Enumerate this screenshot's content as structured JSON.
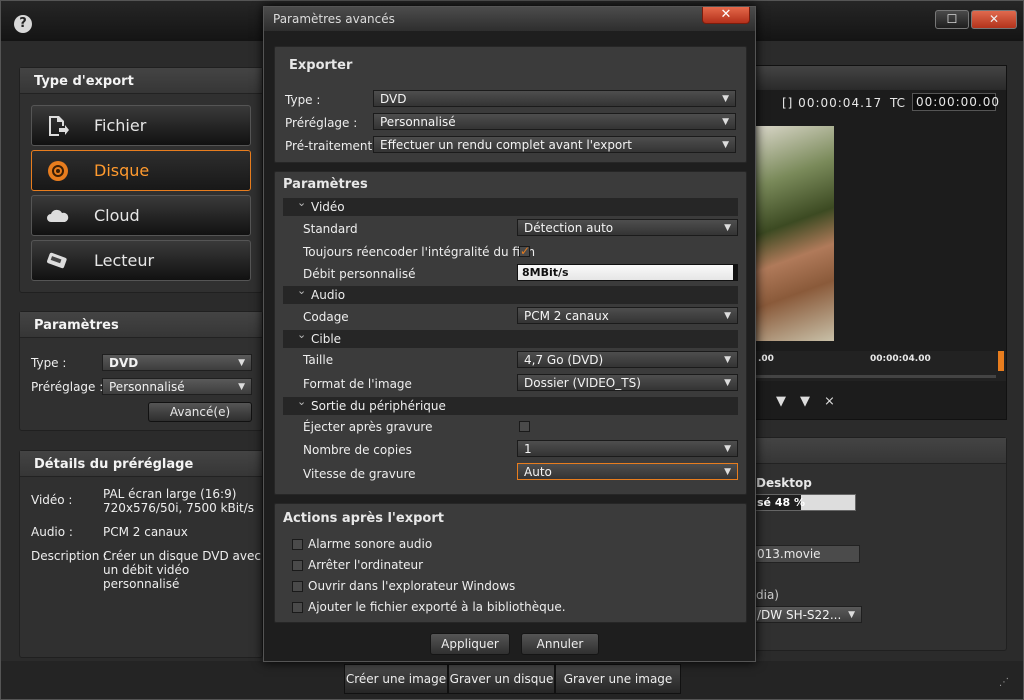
{
  "app": {
    "help": "?",
    "maximize": "☐",
    "close": "✕"
  },
  "export_type": {
    "title": "Type d'export",
    "items": [
      {
        "label": "Fichier",
        "icon": "file-export-icon"
      },
      {
        "label": "Disque",
        "icon": "disc-icon"
      },
      {
        "label": "Cloud",
        "icon": "cloud-icon"
      },
      {
        "label": "Lecteur",
        "icon": "device-icon"
      }
    ]
  },
  "params": {
    "title": "Paramètres",
    "type_label": "Type :",
    "type_value": "DVD",
    "preset_label": "Préréglage :",
    "preset_value": "Personnalisé",
    "advanced": "Avancé(e)"
  },
  "details": {
    "title": "Détails du préréglage",
    "video_label": "Vidéo :",
    "video_value_1": "PAL écran large (16:9)",
    "video_value_2": "720x576/50i, 7500 kBit/s",
    "audio_label": "Audio :",
    "audio_value": "PCM 2 canaux",
    "desc_label": "Description :",
    "desc_value_1": "Créer un disque DVD avec",
    "desc_value_2": "un débit vidéo personnalisé"
  },
  "preview": {
    "timecode": "[] 00:00:04.17",
    "tc_label": "TC",
    "tc_value": "00:00:00.00",
    "ruler_1": ".00",
    "ruler_2": "00:00:04.00"
  },
  "output": {
    "desktop": "Desktop",
    "progress_text": "sé 48 %",
    "progress": 0.48,
    "filename": "013.movie",
    "media": "dia)",
    "drive": "/DW SH-S22..."
  },
  "bottom": {
    "create_image": "Créer une image",
    "burn_disc": "Graver un disque",
    "burn_image": "Graver une image"
  },
  "dialog": {
    "title": "Paramètres avancés",
    "close": "✕",
    "exporter": {
      "title": "Exporter",
      "type_label": "Type :",
      "type_value": "DVD",
      "preset_label": "Préréglage :",
      "preset_value": "Personnalisé",
      "pre_label": "Pré-traitement :",
      "pre_value": "Effectuer un rendu complet avant l'export"
    },
    "settings": {
      "title": "Paramètres",
      "video": {
        "title": "Vidéo",
        "standard_label": "Standard",
        "standard_value": "Détection auto",
        "reencode_label": "Toujours réencoder l'intégralité du film",
        "reencode_checked": true,
        "bitrate_label": "Débit personnalisé",
        "bitrate_value": "8MBit/s"
      },
      "audio": {
        "title": "Audio",
        "codec_label": "Codage",
        "codec_value": "PCM 2 canaux"
      },
      "target": {
        "title": "Cible",
        "size_label": "Taille",
        "size_value": "4,7 Go (DVD)",
        "format_label": "Format de l'image",
        "format_value": "Dossier (VIDEO_TS)"
      },
      "device": {
        "title": "Sortie du périphérique",
        "eject_label": "Éjecter après gravure",
        "copies_label": "Nombre de copies",
        "copies_value": "1",
        "speed_label": "Vitesse de gravure",
        "speed_value": "Auto"
      }
    },
    "actions": {
      "title": "Actions après l'export",
      "items": [
        "Alarme sonore audio",
        "Arrêter l'ordinateur",
        "Ouvrir dans l'explorateur Windows",
        "Ajouter le fichier exporté à la bibliothèque."
      ]
    },
    "apply": "Appliquer",
    "cancel": "Annuler"
  },
  "colors": {
    "accent": "#e87d1e",
    "close": "#c9412a"
  }
}
